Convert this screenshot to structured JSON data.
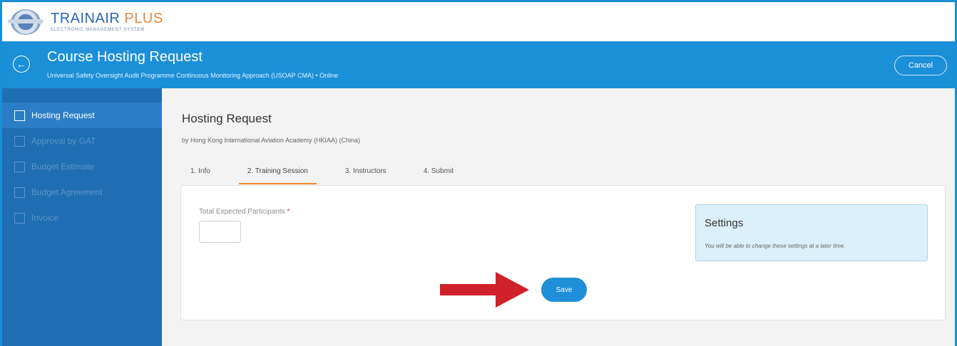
{
  "brand": {
    "name_part1": "TRAINAIR",
    "name_part2": "PLUS",
    "tagline": "ELECTRONIC MANAGEMENT SYSTEM"
  },
  "header": {
    "title": "Course Hosting Request",
    "subtitle": "Universal Safety Oversight Audit Programme Continuous Monitoring Approach (USOAP CMA)  •  Online",
    "cancel_label": "Cancel",
    "back_icon": "arrow-left-circle-icon"
  },
  "sidebar": {
    "items": [
      {
        "label": "Hosting Request",
        "active": true
      },
      {
        "label": "Approval by GAT",
        "active": false
      },
      {
        "label": "Budget Estimate",
        "active": false
      },
      {
        "label": "Budget Agreement",
        "active": false
      },
      {
        "label": "Invoice",
        "active": false
      }
    ]
  },
  "main": {
    "title": "Hosting Request",
    "byline": "by Hong Kong International Aviation Academy (HKIAA) (China)",
    "tabs": [
      {
        "label": "1. Info"
      },
      {
        "label": "2. Training Session",
        "active": true
      },
      {
        "label": "3. Instructors"
      },
      {
        "label": "4. Submit"
      }
    ],
    "form": {
      "participants_label": "Total Expected Participants",
      "required_mark": "*",
      "participants_value": ""
    },
    "settings": {
      "title": "Settings",
      "note": "You will be able to change these settings at a later time."
    },
    "save_label": "Save"
  },
  "colors": {
    "header_blue": "#1b8fd8",
    "sidebar_blue": "#1f6db3",
    "tab_accent": "#f08a30",
    "arrow_red": "#d0212a"
  }
}
